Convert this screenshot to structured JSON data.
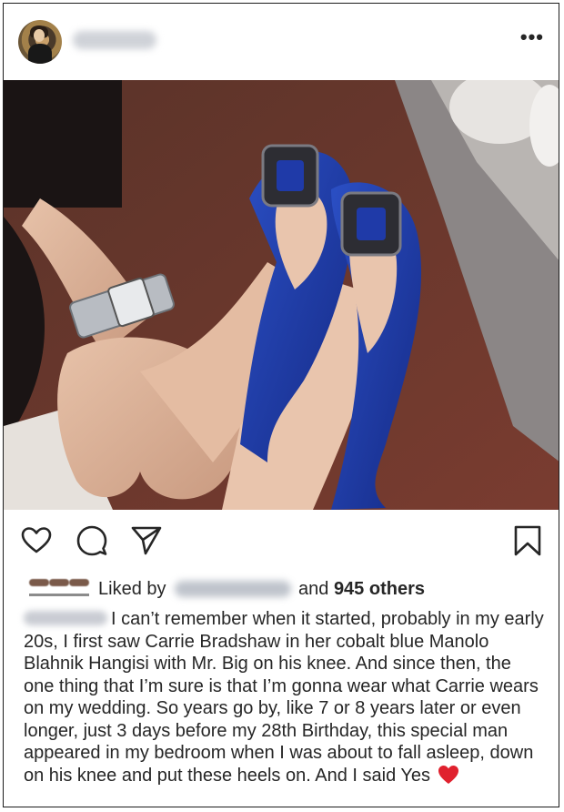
{
  "post": {
    "header": {
      "username_redacted": true,
      "more_icon": "more-horizontal-icon",
      "more_glyph": "•••"
    },
    "photo": {
      "description_icon": "photo"
    },
    "actions": {
      "like_icon": "heart-outline-icon",
      "comment_icon": "comment-bubble-icon",
      "share_icon": "paper-plane-icon",
      "save_icon": "bookmark-outline-icon"
    },
    "likes": {
      "liked_by_label": "Liked by",
      "and_label": "and",
      "others_count": "945 others"
    },
    "caption": {
      "text": "I can’t remember when it started, probably in my early 20s, I first saw Carrie Bradshaw in her cobalt blue Manolo Blahnik Hangisi with Mr. Big on his knee. And since then, the one thing that I’m sure is that I’m gonna wear what Carrie wears on my wedding. So years go by, like 7 or 8 years later or even longer, just 3 days before my 28th Birthday, this special man appeared in my bedroom when I was about to fall asleep, down on his knee and put these heels on. And I said Yes",
      "emoji": "red-heart-emoji"
    },
    "colors": {
      "text": "#262626",
      "heart": "#e0212e",
      "shoe_blue": "#1f3aa8"
    }
  }
}
